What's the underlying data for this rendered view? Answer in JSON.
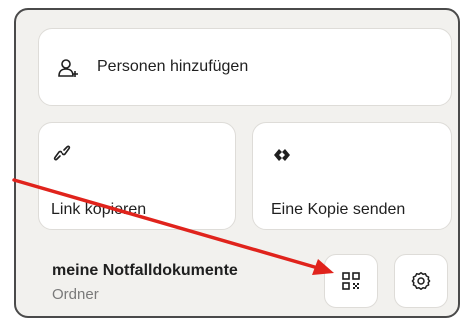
{
  "share_menu": {
    "add_people_label": "Personen hinzufügen",
    "copy_link_label": "Link kopieren",
    "send_copy_label": "Eine Kopie senden",
    "folder_name": "meine Notfalldokumente",
    "folder_type": "Ordner"
  },
  "icons": {
    "add_person": "add-person-icon",
    "link": "link-icon",
    "send_copy": "dropbox-transfer-icon",
    "qr": "qr-code-icon",
    "settings": "settings-gear-icon"
  },
  "annotation": {
    "arrow_color": "#e0231c"
  }
}
